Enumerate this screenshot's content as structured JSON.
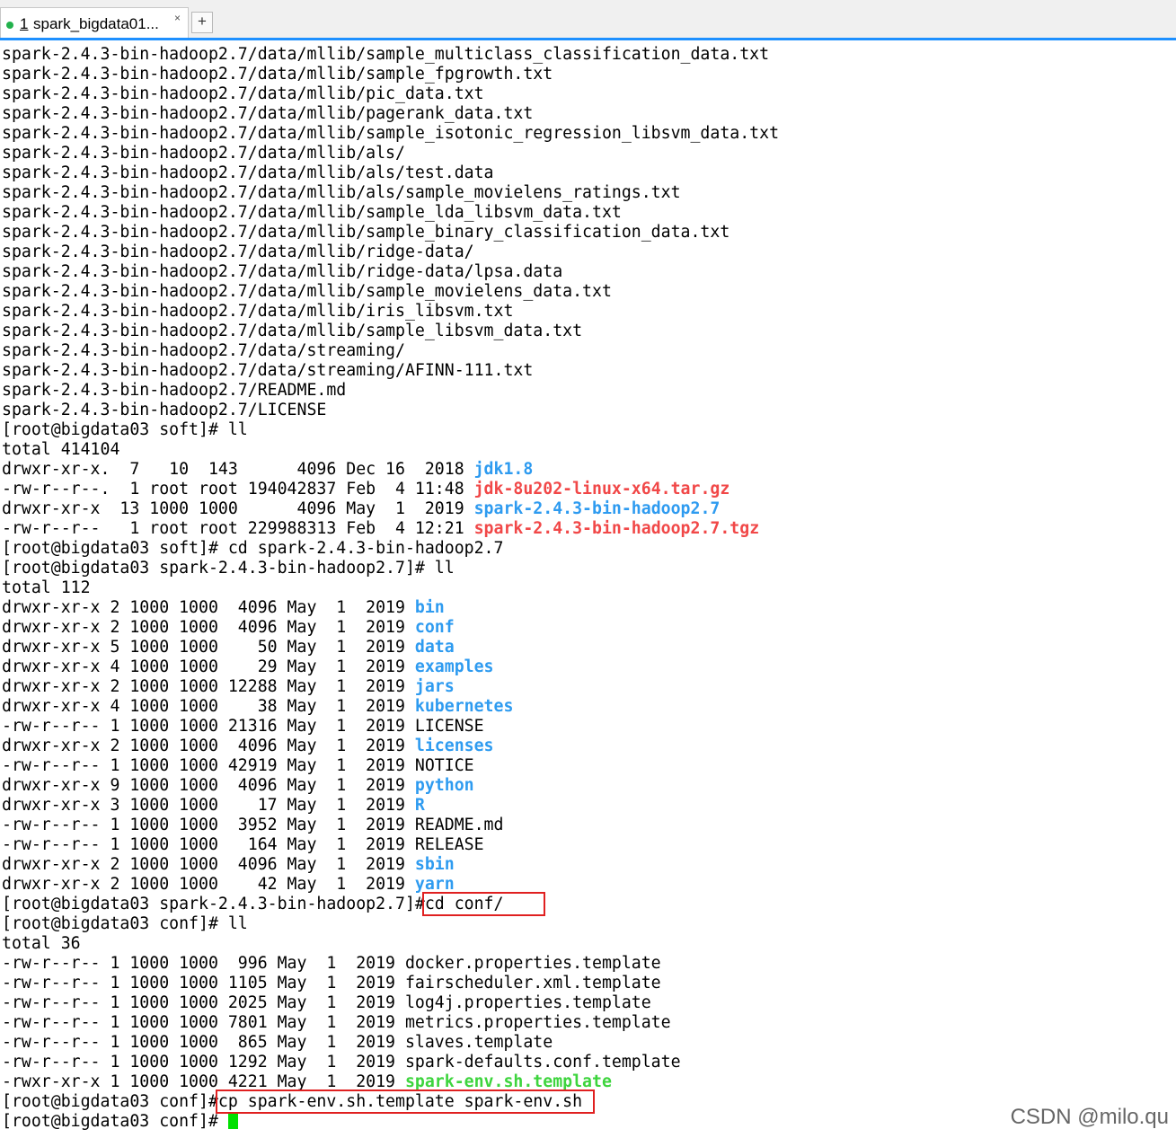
{
  "tab": {
    "number": "1",
    "title": "spark_bigdata01...",
    "close": "×",
    "add": "+"
  },
  "watermark": "CSDN @milo.qu",
  "colors": {
    "dir": "#2e9bf0",
    "archive": "#f14848",
    "exec": "#3dd43d",
    "highlight_box": "#e02020",
    "cursor": "#00e000",
    "accent": "#1e90ff"
  },
  "lines": [
    {
      "t": "spark-2.4.3-bin-hadoop2.7/data/mllib/sample_multiclass_classification_data.txt"
    },
    {
      "t": "spark-2.4.3-bin-hadoop2.7/data/mllib/sample_fpgrowth.txt"
    },
    {
      "t": "spark-2.4.3-bin-hadoop2.7/data/mllib/pic_data.txt"
    },
    {
      "t": "spark-2.4.3-bin-hadoop2.7/data/mllib/pagerank_data.txt"
    },
    {
      "t": "spark-2.4.3-bin-hadoop2.7/data/mllib/sample_isotonic_regression_libsvm_data.txt"
    },
    {
      "t": "spark-2.4.3-bin-hadoop2.7/data/mllib/als/"
    },
    {
      "t": "spark-2.4.3-bin-hadoop2.7/data/mllib/als/test.data"
    },
    {
      "t": "spark-2.4.3-bin-hadoop2.7/data/mllib/als/sample_movielens_ratings.txt"
    },
    {
      "t": "spark-2.4.3-bin-hadoop2.7/data/mllib/sample_lda_libsvm_data.txt"
    },
    {
      "t": "spark-2.4.3-bin-hadoop2.7/data/mllib/sample_binary_classification_data.txt"
    },
    {
      "t": "spark-2.4.3-bin-hadoop2.7/data/mllib/ridge-data/"
    },
    {
      "t": "spark-2.4.3-bin-hadoop2.7/data/mllib/ridge-data/lpsa.data"
    },
    {
      "t": "spark-2.4.3-bin-hadoop2.7/data/mllib/sample_movielens_data.txt"
    },
    {
      "t": "spark-2.4.3-bin-hadoop2.7/data/mllib/iris_libsvm.txt"
    },
    {
      "t": "spark-2.4.3-bin-hadoop2.7/data/mllib/sample_libsvm_data.txt"
    },
    {
      "t": "spark-2.4.3-bin-hadoop2.7/data/streaming/"
    },
    {
      "t": "spark-2.4.3-bin-hadoop2.7/data/streaming/AFINN-111.txt"
    },
    {
      "t": "spark-2.4.3-bin-hadoop2.7/README.md"
    },
    {
      "t": "spark-2.4.3-bin-hadoop2.7/LICENSE"
    },
    {
      "t": "[root@bigdata03 soft]# ll"
    },
    {
      "t": "total 414104"
    },
    {
      "t": "drwxr-xr-x.  7   10  143      4096 Dec 16  2018 ",
      "n": "jdk1.8",
      "c": "blue"
    },
    {
      "t": "-rw-r--r--.  1 root root 194042837 Feb  4 11:48 ",
      "n": "jdk-8u202-linux-x64.tar.gz",
      "c": "red"
    },
    {
      "t": "drwxr-xr-x  13 1000 1000      4096 May  1  2019 ",
      "n": "spark-2.4.3-bin-hadoop2.7",
      "c": "blue"
    },
    {
      "t": "-rw-r--r--   1 root root 229988313 Feb  4 12:21 ",
      "n": "spark-2.4.3-bin-hadoop2.7.tgz",
      "c": "red"
    },
    {
      "t": "[root@bigdata03 soft]# cd spark-2.4.3-bin-hadoop2.7"
    },
    {
      "t": "[root@bigdata03 spark-2.4.3-bin-hadoop2.7]# ll"
    },
    {
      "t": "total 112"
    },
    {
      "t": "drwxr-xr-x 2 1000 1000  4096 May  1  2019 ",
      "n": "bin",
      "c": "blue"
    },
    {
      "t": "drwxr-xr-x 2 1000 1000  4096 May  1  2019 ",
      "n": "conf",
      "c": "blue"
    },
    {
      "t": "drwxr-xr-x 5 1000 1000    50 May  1  2019 ",
      "n": "data",
      "c": "blue"
    },
    {
      "t": "drwxr-xr-x 4 1000 1000    29 May  1  2019 ",
      "n": "examples",
      "c": "blue"
    },
    {
      "t": "drwxr-xr-x 2 1000 1000 12288 May  1  2019 ",
      "n": "jars",
      "c": "blue"
    },
    {
      "t": "drwxr-xr-x 4 1000 1000    38 May  1  2019 ",
      "n": "kubernetes",
      "c": "blue"
    },
    {
      "t": "-rw-r--r-- 1 1000 1000 21316 May  1  2019 LICENSE"
    },
    {
      "t": "drwxr-xr-x 2 1000 1000  4096 May  1  2019 ",
      "n": "licenses",
      "c": "blue"
    },
    {
      "t": "-rw-r--r-- 1 1000 1000 42919 May  1  2019 NOTICE"
    },
    {
      "t": "drwxr-xr-x 9 1000 1000  4096 May  1  2019 ",
      "n": "python",
      "c": "blue"
    },
    {
      "t": "drwxr-xr-x 3 1000 1000    17 May  1  2019 ",
      "n": "R",
      "c": "blue"
    },
    {
      "t": "-rw-r--r-- 1 1000 1000  3952 May  1  2019 README.md"
    },
    {
      "t": "-rw-r--r-- 1 1000 1000   164 May  1  2019 RELEASE"
    },
    {
      "t": "drwxr-xr-x 2 1000 1000  4096 May  1  2019 ",
      "n": "sbin",
      "c": "blue"
    },
    {
      "t": "drwxr-xr-x 2 1000 1000    42 May  1  2019 ",
      "n": "yarn",
      "c": "blue"
    },
    {
      "t": "[root@bigdata03 spark-2.4.3-bin-hadoop2.7]#",
      "h": "cd conf/    "
    },
    {
      "t": "[root@bigdata03 conf]# ll"
    },
    {
      "t": "total 36"
    },
    {
      "t": "-rw-r--r-- 1 1000 1000  996 May  1  2019 docker.properties.template"
    },
    {
      "t": "-rw-r--r-- 1 1000 1000 1105 May  1  2019 fairscheduler.xml.template"
    },
    {
      "t": "-rw-r--r-- 1 1000 1000 2025 May  1  2019 log4j.properties.template"
    },
    {
      "t": "-rw-r--r-- 1 1000 1000 7801 May  1  2019 metrics.properties.template"
    },
    {
      "t": "-rw-r--r-- 1 1000 1000  865 May  1  2019 slaves.template"
    },
    {
      "t": "-rw-r--r-- 1 1000 1000 1292 May  1  2019 spark-defaults.conf.template"
    },
    {
      "t": "-rwxr-xr-x 1 1000 1000 4221 May  1  2019 ",
      "n": "spark-env.sh.template",
      "c": "green"
    },
    {
      "t": "[root@bigdata03 conf]#",
      "h": "cp spark-env.sh.template spark-env.sh "
    },
    {
      "t": "[root@bigdata03 conf]# ",
      "cursor": true
    }
  ]
}
